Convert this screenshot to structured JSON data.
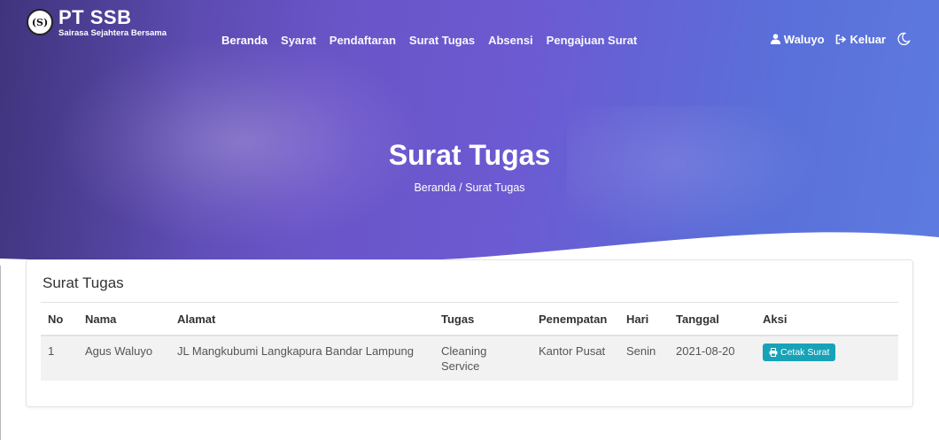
{
  "brand": {
    "logo": "(S)",
    "title": "PT SSB",
    "subtitle": "Sairasa Sejahtera Bersama"
  },
  "nav": {
    "items": [
      {
        "label": "Beranda"
      },
      {
        "label": "Syarat"
      },
      {
        "label": "Pendaftaran"
      },
      {
        "label": "Surat Tugas"
      },
      {
        "label": "Absensi"
      },
      {
        "label": "Pengajuan Surat"
      }
    ],
    "user": "Waluyo",
    "logout": "Keluar",
    "icons": {
      "user": "user-icon",
      "logout": "sign-out-icon",
      "theme": "moon-icon"
    }
  },
  "hero": {
    "title": "Surat Tugas",
    "breadcrumb": "Beranda / Surat Tugas"
  },
  "card": {
    "title": "Surat Tugas",
    "columns": [
      "No",
      "Nama",
      "Alamat",
      "Tugas",
      "Penempatan",
      "Hari",
      "Tanggal",
      "Aksi"
    ],
    "rows": [
      {
        "no": "1",
        "nama": "Agus Waluyo",
        "alamat": "JL Mangkubumi Langkapura Bandar Lampung",
        "tugas": "Cleaning Service",
        "penempatan": "Kantor Pusat",
        "hari": "Senin",
        "tanggal": "2021-08-20",
        "aksi": "Cetak Surat"
      }
    ]
  },
  "colors": {
    "accent": "#17a2b8",
    "hero_start": "#4b3f93",
    "hero_end": "#5d7be0"
  }
}
